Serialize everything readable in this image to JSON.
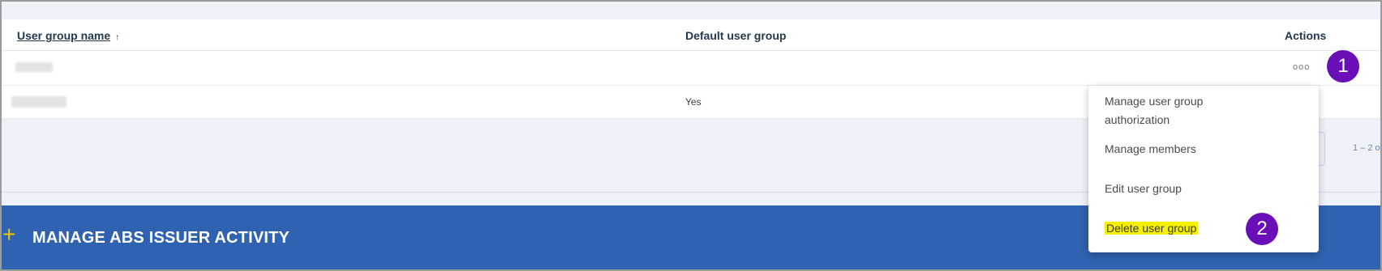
{
  "table": {
    "headers": {
      "name": "User group name",
      "name_sort_icon": "↑",
      "default": "Default user group",
      "actions": "Actions"
    },
    "rows": [
      {
        "default": "",
        "actions_icon": "ooo"
      },
      {
        "default": "Yes"
      }
    ],
    "pagination": {
      "range": "1 – 2 o"
    }
  },
  "menu": {
    "items": [
      {
        "label": "Manage user group authorization"
      },
      {
        "label": "Manage members"
      },
      {
        "label": "Edit user group"
      },
      {
        "label": "Delete user group",
        "highlighted": true
      }
    ]
  },
  "section": {
    "icon": "plus-icon",
    "plus": "+",
    "title": "MANAGE ABS ISSUER ACTIVITY"
  },
  "callouts": [
    "1",
    "2"
  ],
  "colors": {
    "section_bar": "#2f62b0",
    "callout": "#6a0fb8",
    "highlight": "#f5f000",
    "plus_accent": "#f2c400"
  }
}
